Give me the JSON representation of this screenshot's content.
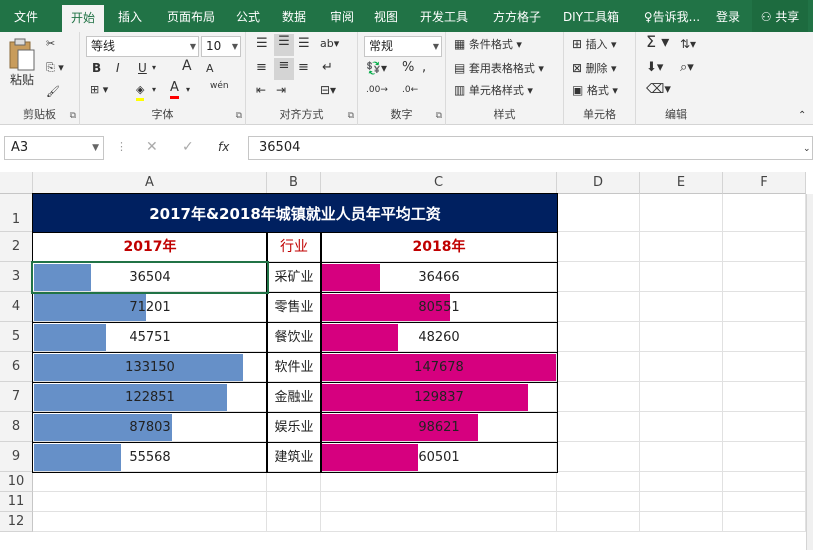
{
  "menubar": {
    "tabs": [
      "文件",
      "开始",
      "插入",
      "页面布局",
      "公式",
      "数据",
      "审阅",
      "视图",
      "开发工具",
      "方方格子",
      "DIY工具箱"
    ],
    "active_tab": "开始",
    "tell_me": "告诉我...",
    "login": "登录",
    "share": "共享"
  },
  "ribbon": {
    "clipboard": {
      "label": "剪贴板",
      "paste": "粘贴"
    },
    "font": {
      "label": "字体",
      "font_name": "等线",
      "font_size": "10",
      "bold": "B",
      "italic": "I",
      "underline": "U",
      "grow": "A",
      "shrink": "A",
      "wen": "wén"
    },
    "alignment": {
      "label": "对齐方式"
    },
    "number": {
      "label": "数字",
      "format": "常规"
    },
    "styles": {
      "label": "样式",
      "conditional": "条件格式",
      "table": "套用表格格式",
      "cell_styles": "单元格样式"
    },
    "cells": {
      "label": "单元格",
      "insert": "插入",
      "delete": "删除",
      "format": "格式"
    },
    "editing": {
      "label": "编辑"
    }
  },
  "formula_bar": {
    "name_box": "A3",
    "fx": "fx",
    "value": "36504"
  },
  "columns": [
    "A",
    "B",
    "C",
    "D",
    "E",
    "F"
  ],
  "rows": [
    "1",
    "2",
    "3",
    "4",
    "5",
    "6",
    "7",
    "8",
    "9",
    "10",
    "11",
    "12"
  ],
  "table": {
    "title": "2017年&2018年城镇就业人员年平均工资",
    "headers": [
      "2017年",
      "行业",
      "2018年"
    ],
    "data_bar_max": 147678,
    "colors": {
      "title_bg": "#002060",
      "header_text": "#c00000",
      "bar_2017": "#6690c8",
      "bar_2018": "#d6007f"
    },
    "rows": [
      {
        "y2017": 36504,
        "industry": "采矿业",
        "y2018": 36466
      },
      {
        "y2017": 71201,
        "industry": "零售业",
        "y2018": 80551
      },
      {
        "y2017": 45751,
        "industry": "餐饮业",
        "y2018": 48260
      },
      {
        "y2017": 133150,
        "industry": "软件业",
        "y2018": 147678
      },
      {
        "y2017": 122851,
        "industry": "金融业",
        "y2018": 129837
      },
      {
        "y2017": 87803,
        "industry": "娱乐业",
        "y2018": 98621
      },
      {
        "y2017": 55568,
        "industry": "建筑业",
        "y2018": 60501
      }
    ]
  }
}
